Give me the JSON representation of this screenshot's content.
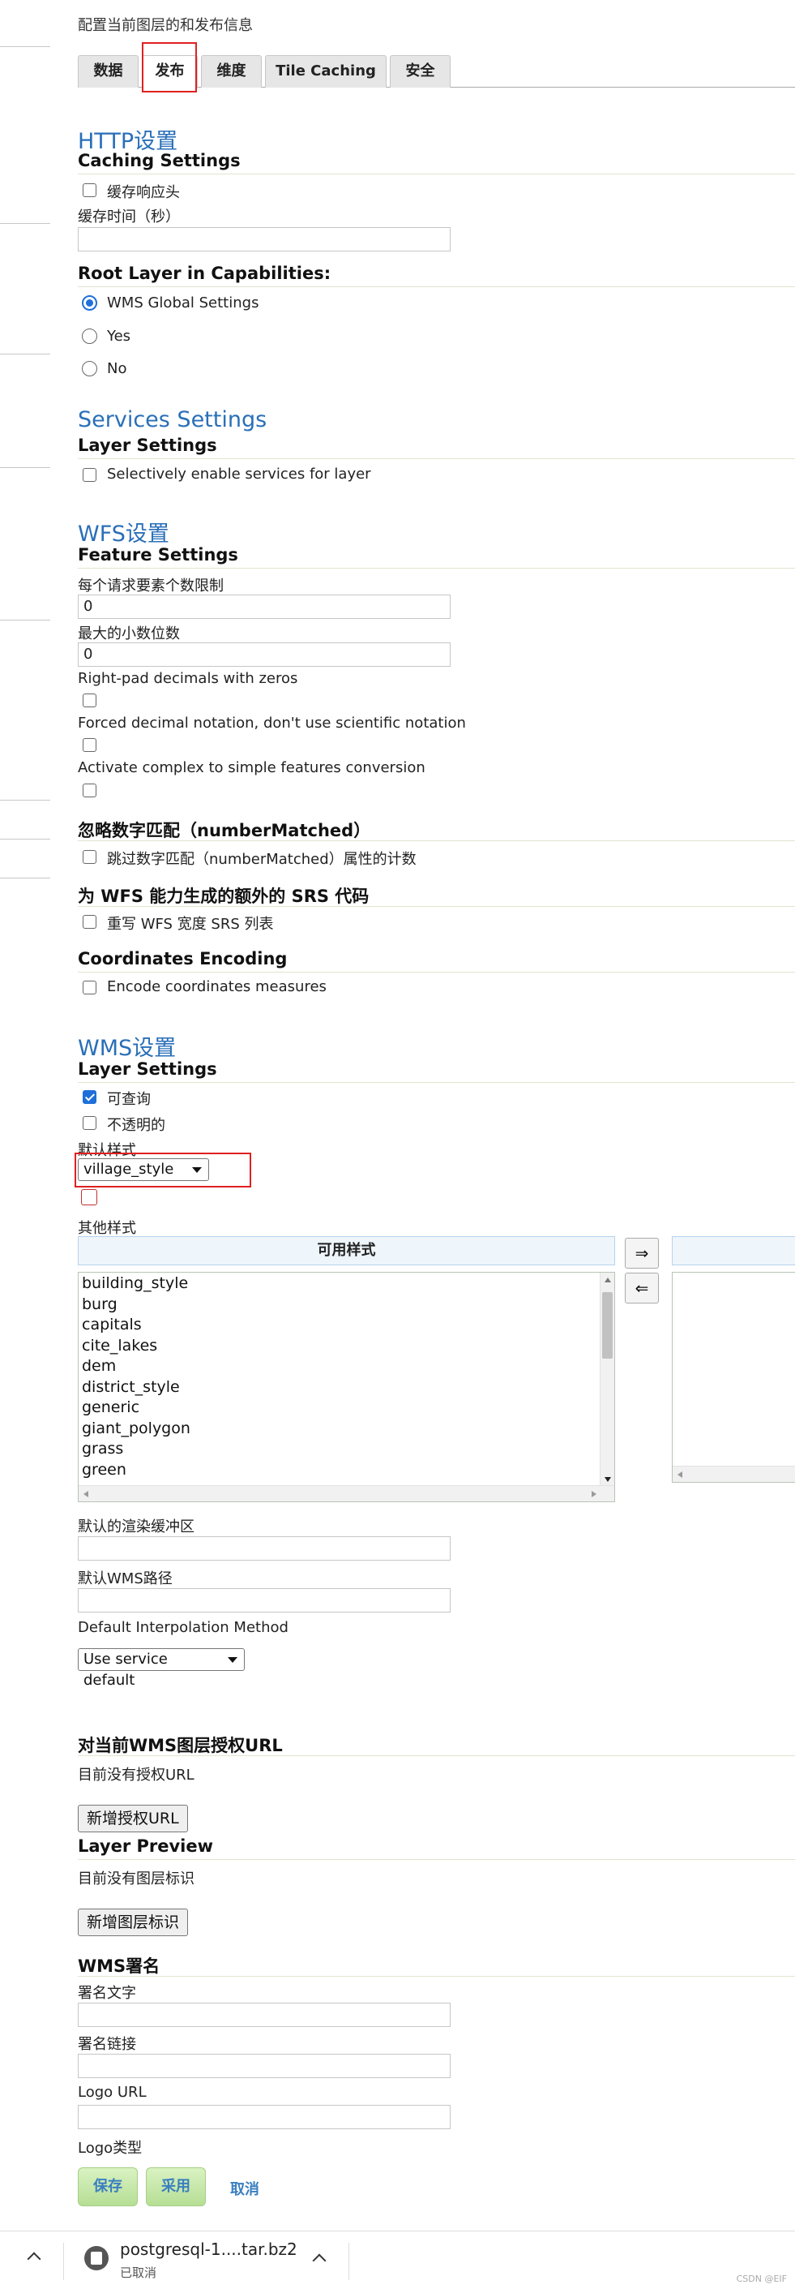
{
  "page": {
    "description": "配置当前图层的和发布信息"
  },
  "tabs": [
    {
      "label": "数据",
      "active": false
    },
    {
      "label": "发布",
      "active": true
    },
    {
      "label": "维度",
      "active": false
    },
    {
      "label": "Tile Caching",
      "active": false
    },
    {
      "label": "安全",
      "active": false
    }
  ],
  "http": {
    "title": "HTTP设置",
    "caching_title": "Caching Settings",
    "cache_headers_label": "缓存响应头",
    "cache_time_label": "缓存时间（秒）",
    "cache_time_value": "",
    "root_layer_title": "Root Layer in Capabilities:",
    "root_options": [
      {
        "label": "WMS Global Settings",
        "checked": true
      },
      {
        "label": "Yes",
        "checked": false
      },
      {
        "label": "No",
        "checked": false
      }
    ]
  },
  "services": {
    "title": "Services Settings",
    "layer_title": "Layer Settings",
    "selective_label": "Selectively enable services for layer"
  },
  "wfs": {
    "title": "WFS设置",
    "feature_title": "Feature Settings",
    "max_features_label": "每个请求要素个数限制",
    "max_features_value": "0",
    "max_decimals_label": "最大的小数位数",
    "max_decimals_value": "0",
    "right_pad_label": "Right-pad decimals with zeros",
    "forced_decimal_label": "Forced decimal notation, don't use scientific notation",
    "complex_label": "Activate complex to simple features conversion",
    "number_matched_title": "忽略数字匹配（numberMatched）",
    "number_matched_label": "跳过数字匹配（numberMatched）属性的计数",
    "srs_title": "为 WFS 能力生成的额外的 SRS 代码",
    "srs_label": "重写 WFS 宽度 SRS 列表",
    "coords_title": "Coordinates Encoding",
    "coords_label": "Encode coordinates measures"
  },
  "wms": {
    "title": "WMS设置",
    "layer_title": "Layer Settings",
    "queryable_label": "可查询",
    "opaque_label": "不透明的",
    "default_style_label": "默认样式",
    "default_style_value": "village_style",
    "other_styles_label": "其他样式",
    "available_styles_header": "可用样式",
    "available_styles": [
      "building_style",
      "burg",
      "capitals",
      "cite_lakes",
      "dem",
      "district_style",
      "generic",
      "giant_polygon",
      "grass",
      "green"
    ],
    "move_right": "⇒",
    "move_left": "⇐",
    "buffer_label": "默认的渲染缓冲区",
    "buffer_value": "",
    "path_label": "默认WMS路径",
    "path_value": "",
    "interp_label": "Default Interpolation Method",
    "interp_value": "Use service default",
    "auth_title": "对当前WMS图层授权URL",
    "auth_empty": "目前没有授权URL",
    "auth_button": "新增授权URL",
    "preview_title": "Layer Preview",
    "preview_empty": "目前没有图层标识",
    "preview_button": "新增图层标识",
    "attr_title": "WMS署名",
    "attr_text_label": "署名文字",
    "attr_link_label": "署名链接",
    "logo_url_label": "Logo URL",
    "logo_type_label": "Logo类型"
  },
  "actions": {
    "save": "保存",
    "apply": "采用",
    "cancel": "取消"
  },
  "download": {
    "filename": "postgresql-1....tar.bz2",
    "status": "已取消"
  },
  "watermark": "CSDN @EIF",
  "colors": {
    "heading_blue": "#2a6fb8",
    "highlight_red": "#e02020",
    "checkbox_blue": "#1e6fd9",
    "button_green": "#b6de95"
  }
}
